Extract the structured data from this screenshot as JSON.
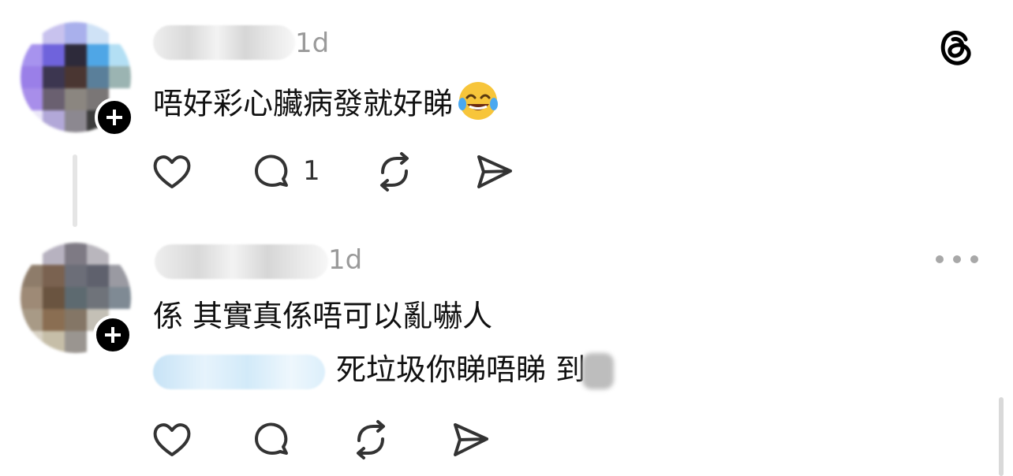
{
  "app": {
    "logo_icon": "threads-logo-icon",
    "accent": "#000000"
  },
  "posts": [
    {
      "username": "",
      "timestamp": "1d",
      "text": "唔好彩心臟病發就好睇",
      "emoji": "face-with-tears-of-joy",
      "actions": {
        "like_icon": "heart-icon",
        "reply_icon": "comment-icon",
        "reply_count": "1",
        "repost_icon": "repost-icon",
        "share_icon": "send-icon"
      }
    },
    {
      "username": "",
      "timestamp": "1d",
      "text": "係 其實真係唔可以亂嚇人",
      "reply_line": "死垃圾你睇唔睇 到",
      "actions": {
        "like_icon": "heart-icon",
        "reply_icon": "comment-icon",
        "repost_icon": "repost-icon",
        "share_icon": "send-icon"
      }
    }
  ]
}
